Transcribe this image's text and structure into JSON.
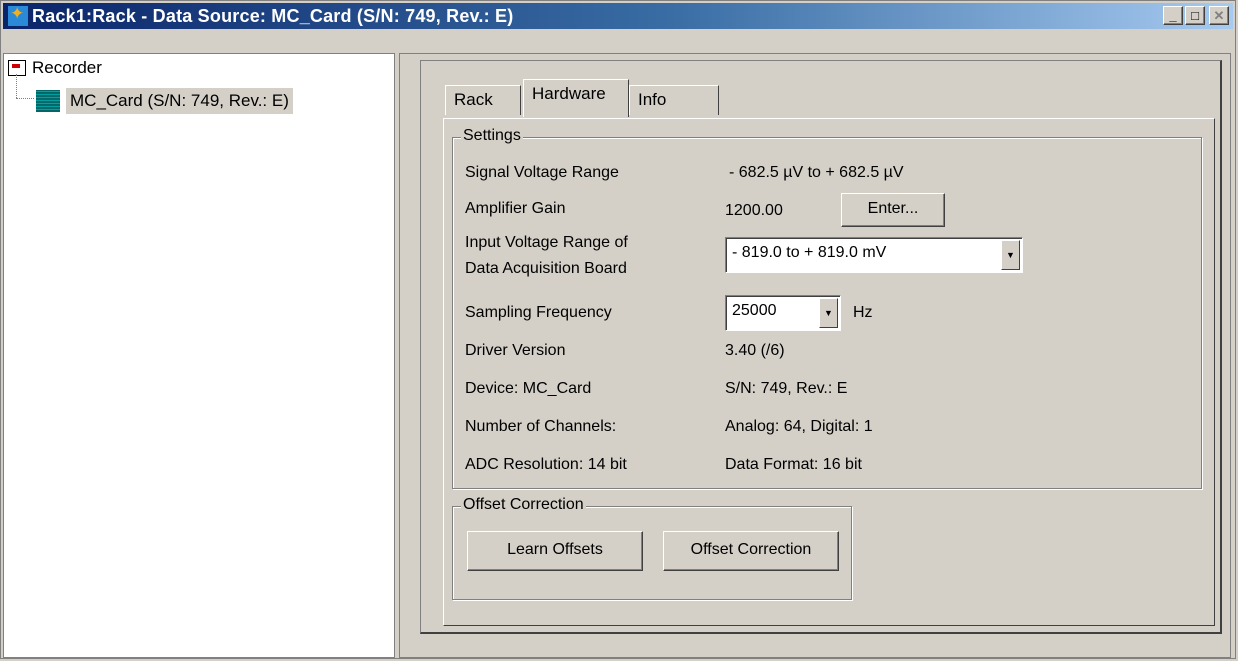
{
  "window": {
    "title": "Rack1:Rack - Data Source: MC_Card (S/N: 749, Rev.: E)",
    "controls": {
      "minimize": "_",
      "maximize": "□",
      "close": "✕"
    }
  },
  "tree": {
    "root_label": "Recorder",
    "child_label": "MC_Card (S/N: 749, Rev.: E)"
  },
  "tabs": [
    {
      "label": "Rack"
    },
    {
      "label": "Hardware",
      "active": true
    },
    {
      "label": "Info"
    }
  ],
  "settings": {
    "legend": "Settings",
    "signal_voltage_range": {
      "label": "Signal Voltage Range",
      "value": "- 682.5 µV to + 682.5 µV"
    },
    "amplifier_gain": {
      "label": "Amplifier Gain",
      "value": "1200.00",
      "button": "Enter..."
    },
    "input_voltage_range": {
      "label_line1": "Input Voltage Range of",
      "label_line2": "Data Acquisition Board",
      "selected": "-  819.0  to +  819.0 mV"
    },
    "sampling_frequency": {
      "label": "Sampling Frequency",
      "selected": "25000",
      "unit": "Hz"
    },
    "driver_version": {
      "label": "Driver Version",
      "value": "3.40 (/6)"
    },
    "device": {
      "label": "Device: MC_Card",
      "value": "S/N: 749, Rev.: E"
    },
    "channels": {
      "label": "Number of Channels:",
      "value": "Analog: 64, Digital: 1"
    },
    "adc": {
      "label": "ADC Resolution: 14 bit",
      "value": "Data Format: 16 bit"
    }
  },
  "offset_correction": {
    "legend": "Offset Correction",
    "learn_button": "Learn Offsets",
    "correction_button": "Offset Correction"
  },
  "colors": {
    "titlebar_start": "#0a246a",
    "titlebar_end": "#a6caf0",
    "face": "#d4d0c8"
  }
}
